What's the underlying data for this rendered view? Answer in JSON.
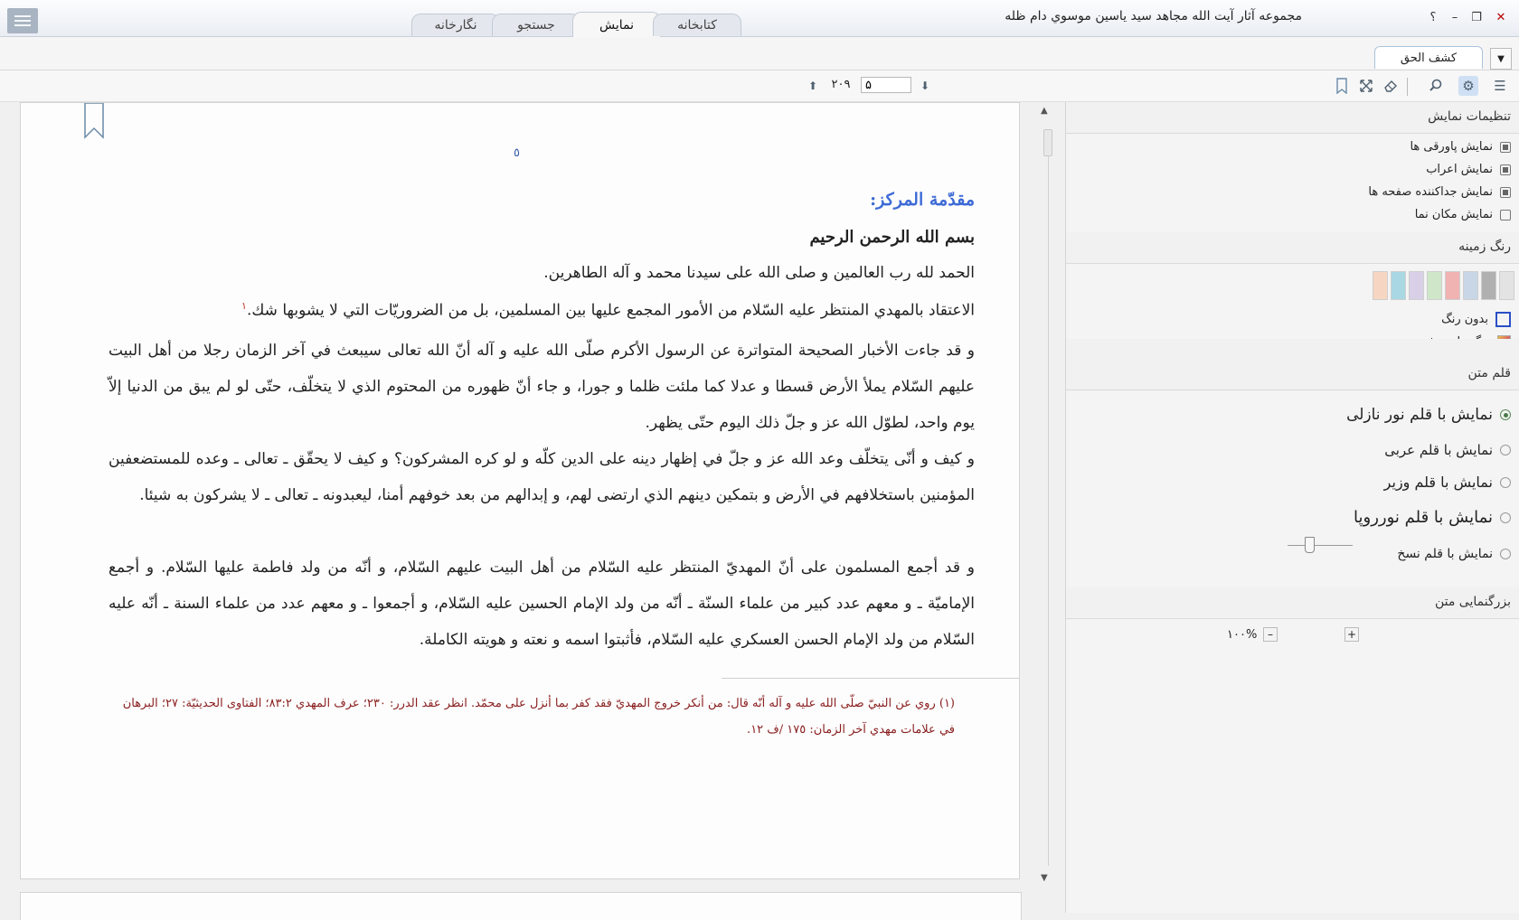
{
  "window": {
    "title": "مجموعه آثار آیت الله مجاهد سید یاسین موسوي دام ظله",
    "help": "؟",
    "minimize": "–",
    "restore": "❐",
    "close": "✕"
  },
  "main_tabs": [
    {
      "label": "نگارخانه"
    },
    {
      "label": "جستجو"
    },
    {
      "label": "نمایش",
      "active": true
    },
    {
      "label": "کتابخانه"
    }
  ],
  "book_tab": {
    "label": "کشف الحق"
  },
  "toolbar": {
    "current_page": "۵",
    "total_pages": "۲۰۹"
  },
  "document": {
    "page_number": "٥",
    "heading": "مقدّمة المركز:",
    "basmala": "بسم الله الرحمن الرحيم",
    "lines": {
      "l1": "الحمد لله رب العالمين و صلى الله على سيدنا محمد و آله الطاهرين.",
      "l2": "الاعتقاد بالمهدي المنتظر عليه السّلام من الأمور المجمع عليها بين المسلمين، بل من الضروريّات التي لا يشوبها شك.",
      "l2_note": "١",
      "p1": "و قد جاءت الأخبار الصحيحة المتواترة عن الرسول الأكرم صلّى الله عليه و آله أنّ الله تعالى سيبعث في آخر الزمان رجلا من أهل البيت عليهم السّلام يملأ الأرض قسطا و عدلا كما ملئت ظلما و جورا، و جاء أنّ ظهوره من المحتوم الذي لا يتخلّف، حتّى لو لم يبق من الدنيا إلاّ يوم واحد، لطوّل الله عز و جلّ ذلك اليوم حتّى يظهر.",
      "p2": "و كيف و أنّى يتخلّف وعد الله عز و جلّ في إظهار دينه على الدين كلّه و لو كره المشركون؟ و كيف لا يحقّق ـ تعالى ـ وعده للمستضعفين المؤمنين باستخلافهم في الأرض و بتمكين دينهم الذي ارتضى لهم، و إبدالهم من بعد خوفهم أمنا، ليعبدونه ـ تعالى ـ لا يشركون به شيئا.",
      "p3": "و قد أجمع المسلمون على أنّ المهديّ المنتظر عليه السّلام من أهل البيت عليهم السّلام، و أنّه من ولد فاطمة عليها السّلام. و أجمع الإماميّة ـ و معهم عدد كبير من علماء السنّة ـ أنّه من ولد الإمام الحسين عليه السّلام، و أجمعوا ـ و معهم عدد من علماء السنة ـ أنّه عليه السّلام من ولد الإمام الحسن العسكري عليه السّلام، فأثبتوا اسمه و نعته و هويته الكاملة."
    },
    "footnote": "(١) روي عن النبيّ صلّى الله عليه و آله أنّه قال: من أنكر خروج المهديّ فقد كفر بما أنزل على محمّد. انظر عقد الدرر: ٢٣٠؛ عرف المهدي ٨٣:٢؛ الفتاوى الحديثيّة: ٢٧؛ البرهان في علامات مهدي آخر الزمان: ١٧٥ /ف ١٢."
  },
  "settings": {
    "display_title": "تنظیمات نمایش",
    "checkboxes": [
      {
        "label": "نمایش پاورقی ها",
        "checked": true
      },
      {
        "label": "نمایش اعراب",
        "checked": true
      },
      {
        "label": "نمایش جداکننده صفحه ها",
        "checked": true
      },
      {
        "label": "نمایش مکان نما",
        "checked": false
      }
    ],
    "bg_title": "رنگ زمینه",
    "swatch_colors": [
      "#e3e3e3",
      "#b0b0b0",
      "#c9d6e6",
      "#f1b2b2",
      "#cfe6c8",
      "#d9d0e8",
      "#a9d8e3",
      "#f6d6c2"
    ],
    "no_color": "بدون رنگ",
    "more_colors": "رنگ های بیشتر",
    "font_title": "قلم متن",
    "fonts": [
      {
        "label": "نمایش با قلم نور نازلی",
        "selected": true
      },
      {
        "label": "نمایش با قلم عربی",
        "selected": false
      },
      {
        "label": "نمایش با قلم وزیر",
        "selected": false
      },
      {
        "label": "نمایش با قلم نورروپا",
        "selected": false
      },
      {
        "label": "نمایش با قلم نسخ",
        "selected": false
      }
    ],
    "zoom_title": "بزرگنمایی متن",
    "zoom_value": "۱۰۰%",
    "zoom_minus": "–",
    "zoom_plus": "+"
  }
}
